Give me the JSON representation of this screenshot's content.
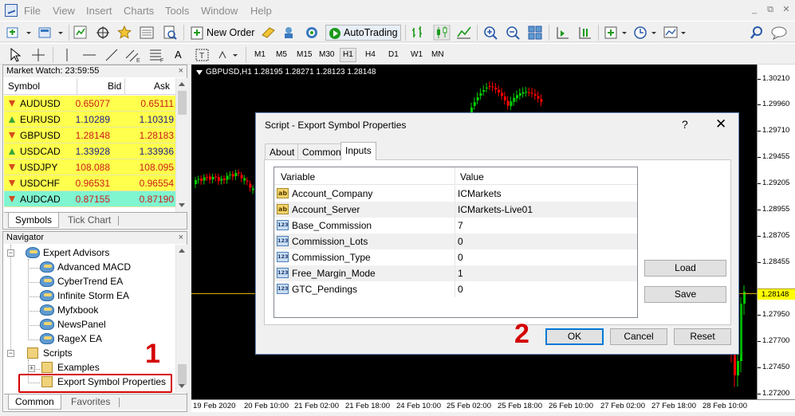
{
  "menu": {
    "items": [
      "File",
      "View",
      "Insert",
      "Charts",
      "Tools",
      "Window",
      "Help"
    ]
  },
  "toolbar": {
    "new_order_label": "New Order",
    "autotrading_label": "AutoTrading",
    "timeframes": [
      "M1",
      "M5",
      "M15",
      "M30",
      "H1",
      "H4",
      "D1",
      "W1",
      "MN"
    ],
    "active_timeframe": "H1"
  },
  "market_watch": {
    "title": "Market Watch: 23:59:55",
    "columns": [
      "Symbol",
      "Bid",
      "Ask"
    ],
    "rows": [
      {
        "symbol": "AUDUSD",
        "bid": "0.65077",
        "ask": "0.65111",
        "direction": "down"
      },
      {
        "symbol": "EURUSD",
        "bid": "1.10289",
        "ask": "1.10319",
        "direction": "up"
      },
      {
        "symbol": "GBPUSD",
        "bid": "1.28148",
        "ask": "1.28183",
        "direction": "down"
      },
      {
        "symbol": "USDCAD",
        "bid": "1.33928",
        "ask": "1.33936",
        "direction": "up"
      },
      {
        "symbol": "USDJPY",
        "bid": "108.088",
        "ask": "108.095",
        "direction": "down"
      },
      {
        "symbol": "USDCHF",
        "bid": "0.96531",
        "ask": "0.96554",
        "direction": "down"
      },
      {
        "symbol": "AUDCAD",
        "bid": "0.87155",
        "ask": "0.87190",
        "direction": "down"
      }
    ],
    "tabs": [
      "Symbols",
      "Tick Chart"
    ],
    "row_color": "#ffff4d",
    "selected_row_color": "#7ff5d0"
  },
  "navigator": {
    "title": "Navigator",
    "expert_advisors_label": "Expert Advisors",
    "experts": [
      "Advanced MACD",
      "CyberTrend EA",
      "Infinite Storm EA",
      "Myfxbook",
      "NewsPanel",
      "RageX EA"
    ],
    "scripts_label": "Scripts",
    "examples_label": "Examples",
    "highlighted_script": "Export Symbol Properties",
    "tabs": [
      "Common",
      "Favorites"
    ]
  },
  "chart": {
    "title": "GBPUSD,H1  1.28195 1.28271 1.28123 1.28148",
    "price_labels": [
      "1.30210",
      "1.29960",
      "1.29710",
      "1.29455",
      "1.29205",
      "1.28955",
      "1.28705",
      "1.28455",
      "1.28148",
      "1.27950",
      "1.27700",
      "1.27450",
      "1.27200"
    ],
    "current_price": "1.28148",
    "time_labels": [
      "19 Feb 2020",
      "20 Feb 10:00",
      "21 Feb 02:00",
      "21 Feb 18:00",
      "24 Feb 10:00",
      "25 Feb 02:00",
      "25 Feb 18:00",
      "26 Feb 10:00",
      "27 Feb 02:00",
      "27 Feb 18:00",
      "28 Feb 10:00"
    ],
    "bull_color": "#00d000",
    "bear_color": "#ff0000"
  },
  "dialog": {
    "title": "Script - Export Symbol Properties",
    "help_label": "?",
    "close_label": "✕",
    "tabs": [
      "About",
      "Common",
      "Inputs"
    ],
    "active_tab": "Inputs",
    "columns": [
      "Variable",
      "Value"
    ],
    "params": [
      {
        "type": "ab",
        "name": "Account_Company",
        "value": "ICMarkets"
      },
      {
        "type": "ab",
        "name": "Account_Server",
        "value": "ICMarkets-Live01"
      },
      {
        "type": "123",
        "name": "Base_Commission",
        "value": "7"
      },
      {
        "type": "123",
        "name": "Commission_Lots",
        "value": "0"
      },
      {
        "type": "123",
        "name": "Commission_Type",
        "value": "0"
      },
      {
        "type": "123",
        "name": "Free_Margin_Mode",
        "value": "1"
      },
      {
        "type": "123",
        "name": "GTC_Pendings",
        "value": "0"
      }
    ],
    "type_labels": {
      "ab": "ab",
      "123": "123"
    },
    "load_label": "Load",
    "save_label": "Save",
    "ok_label": "OK",
    "cancel_label": "Cancel",
    "reset_label": "Reset"
  },
  "annotations": {
    "step1": "1",
    "step2": "2",
    "color": "#d40000"
  }
}
